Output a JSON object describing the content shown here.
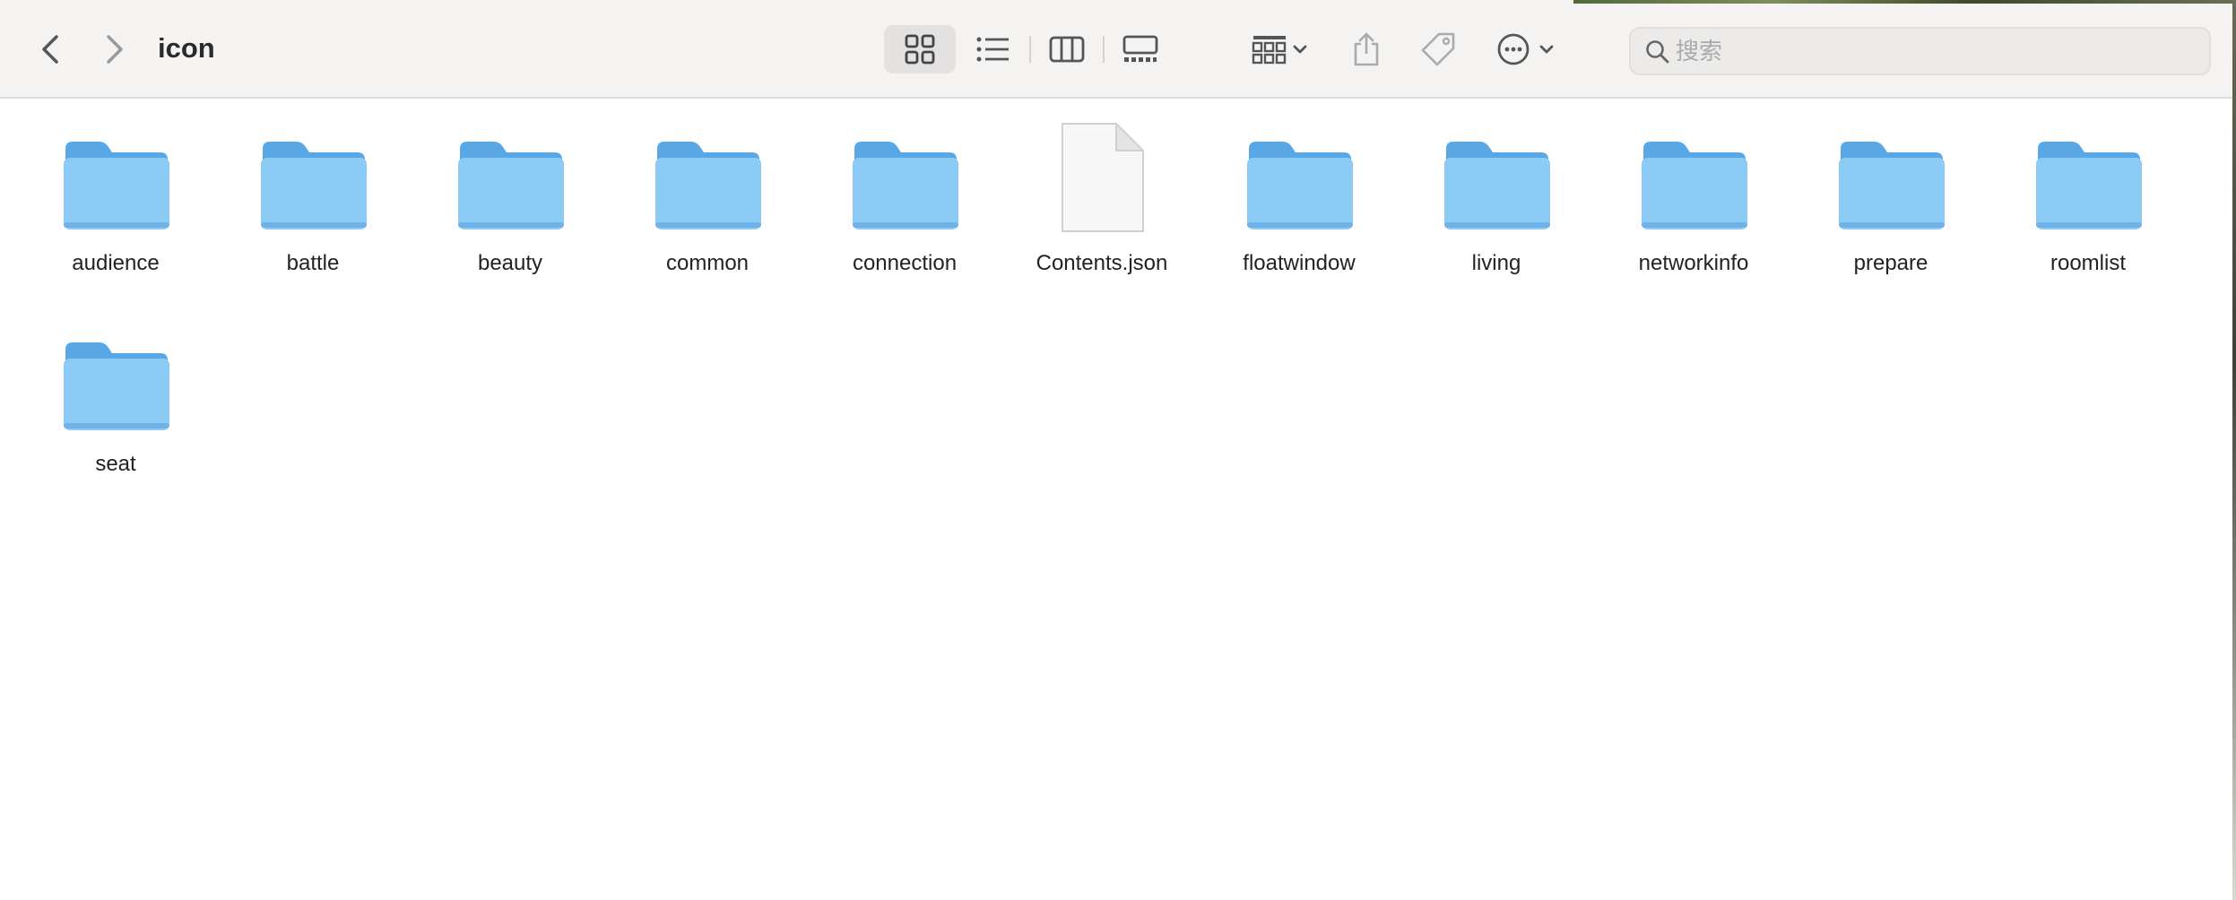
{
  "window": {
    "title": "icon"
  },
  "toolbar": {
    "back_icon": "chevron-left-icon",
    "forward_icon": "chevron-right-icon",
    "views": [
      "icon-view",
      "list-view",
      "column-view",
      "gallery-view"
    ],
    "active_view": "icon-view",
    "group_icon": "group-grid-icon",
    "share_icon": "share-icon",
    "tag_icon": "tag-icon",
    "more_icon": "ellipsis-circle-icon"
  },
  "search": {
    "placeholder": "搜索",
    "value": ""
  },
  "items": [
    {
      "name": "audience",
      "kind": "folder"
    },
    {
      "name": "battle",
      "kind": "folder"
    },
    {
      "name": "beauty",
      "kind": "folder"
    },
    {
      "name": "common",
      "kind": "folder"
    },
    {
      "name": "connection",
      "kind": "folder"
    },
    {
      "name": "Contents.json",
      "kind": "file"
    },
    {
      "name": "floatwindow",
      "kind": "folder"
    },
    {
      "name": "living",
      "kind": "folder"
    },
    {
      "name": "networkinfo",
      "kind": "folder"
    },
    {
      "name": "prepare",
      "kind": "folder"
    },
    {
      "name": "roomlist",
      "kind": "folder"
    },
    {
      "name": "seat",
      "kind": "folder"
    }
  ],
  "colors": {
    "folder_body": "#8ccbf5",
    "folder_tab": "#5aa7e6",
    "toolbar_bg": "#f4f3f2",
    "icon_gray": "#6f6f6f"
  }
}
